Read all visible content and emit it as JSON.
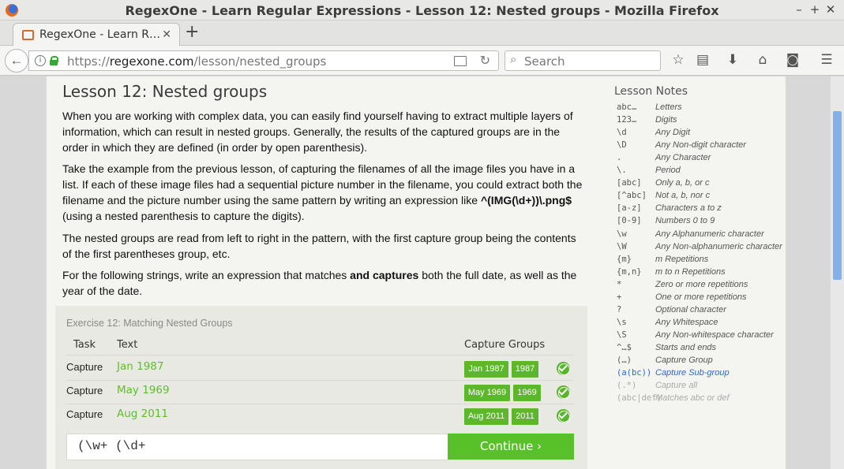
{
  "window": {
    "title": "RegexOne - Learn Regular Expressions - Lesson 12: Nested groups - Mozilla Firefox"
  },
  "tab": {
    "title": "RegexOne - Learn R…"
  },
  "urlbar": {
    "scheme": "https://",
    "host": "regexone.com",
    "path": "/lesson/nested_groups"
  },
  "search": {
    "placeholder": "Search"
  },
  "lesson": {
    "title": "Lesson 12: Nested groups",
    "p1": "When you are working with complex data, you can easily find yourself having to extract multiple layers of information, which can result in nested groups. Generally, the results of the captured groups are in the order in which they are defined (in order by open parenthesis).",
    "p2_a": "Take the example from the previous lesson, of capturing the filenames of all the image files you have in a list. If each of these image files had a sequential picture number in the filename, you could extract both the filename and the picture number using the same pattern by writing an expression like ",
    "p2_b": "^(IMG(\\d+))\\.png$",
    "p2_c": " (using a nested parenthesis to capture the digits).",
    "p3": "The nested groups are read from left to right in the pattern, with the first capture group being the contents of the first parentheses group, etc.",
    "p4_a": "For the following strings, write an expression that matches ",
    "p4_b": "and captures",
    "p4_c": " both the full date, as well as the year of the date."
  },
  "exercise": {
    "title": "Exercise 12: Matching Nested Groups",
    "headers": {
      "task": "Task",
      "text": "Text",
      "groups": "Capture Groups"
    },
    "rows": [
      {
        "task": "Capture",
        "text": "Jan 1987",
        "groups": [
          "Jan 1987",
          "1987"
        ]
      },
      {
        "task": "Capture",
        "text": "May 1969",
        "groups": [
          "May 1969",
          "1969"
        ]
      },
      {
        "task": "Capture",
        "text": "Aug 2011",
        "groups": [
          "Aug 2011",
          "2011"
        ]
      }
    ],
    "answer": "(\\w+ (\\d+",
    "continue_label": "Continue ›"
  },
  "notes": {
    "title": "Lesson Notes",
    "items": [
      {
        "sym": "abc…",
        "desc": "Letters",
        "style": "normal"
      },
      {
        "sym": "123…",
        "desc": "Digits",
        "style": "normal"
      },
      {
        "sym": "\\d",
        "desc": "Any Digit",
        "style": "normal"
      },
      {
        "sym": "\\D",
        "desc": "Any Non-digit character",
        "style": "normal"
      },
      {
        "sym": ".",
        "desc": "Any Character",
        "style": "normal"
      },
      {
        "sym": "\\.",
        "desc": "Period",
        "style": "normal"
      },
      {
        "sym": "[abc]",
        "desc": "Only a, b, or c",
        "style": "normal"
      },
      {
        "sym": "[^abc]",
        "desc": "Not a, b, nor c",
        "style": "normal"
      },
      {
        "sym": "[a-z]",
        "desc": "Characters a to z",
        "style": "normal"
      },
      {
        "sym": "[0-9]",
        "desc": "Numbers 0 to 9",
        "style": "normal"
      },
      {
        "sym": "\\w",
        "desc": "Any Alphanumeric character",
        "style": "normal"
      },
      {
        "sym": "\\W",
        "desc": "Any Non-alphanumeric character",
        "style": "normal"
      },
      {
        "sym": "{m}",
        "desc": "m Repetitions",
        "style": "normal"
      },
      {
        "sym": "{m,n}",
        "desc": "m to n Repetitions",
        "style": "normal"
      },
      {
        "sym": "*",
        "desc": "Zero or more repetitions",
        "style": "normal"
      },
      {
        "sym": "+",
        "desc": "One or more repetitions",
        "style": "normal"
      },
      {
        "sym": "?",
        "desc": "Optional character",
        "style": "normal"
      },
      {
        "sym": "\\s",
        "desc": "Any Whitespace",
        "style": "normal"
      },
      {
        "sym": "\\S",
        "desc": "Any Non-whitespace character",
        "style": "normal"
      },
      {
        "sym": "^…$",
        "desc": "Starts and ends",
        "style": "normal"
      },
      {
        "sym": "(…)",
        "desc": "Capture Group",
        "style": "normal"
      },
      {
        "sym": "(a(bc))",
        "desc": "Capture Sub-group",
        "style": "blue"
      },
      {
        "sym": "(.*)",
        "desc": "Capture all",
        "style": "grey"
      },
      {
        "sym": "(abc|def)",
        "desc": "Matches abc or def",
        "style": "grey"
      }
    ]
  }
}
